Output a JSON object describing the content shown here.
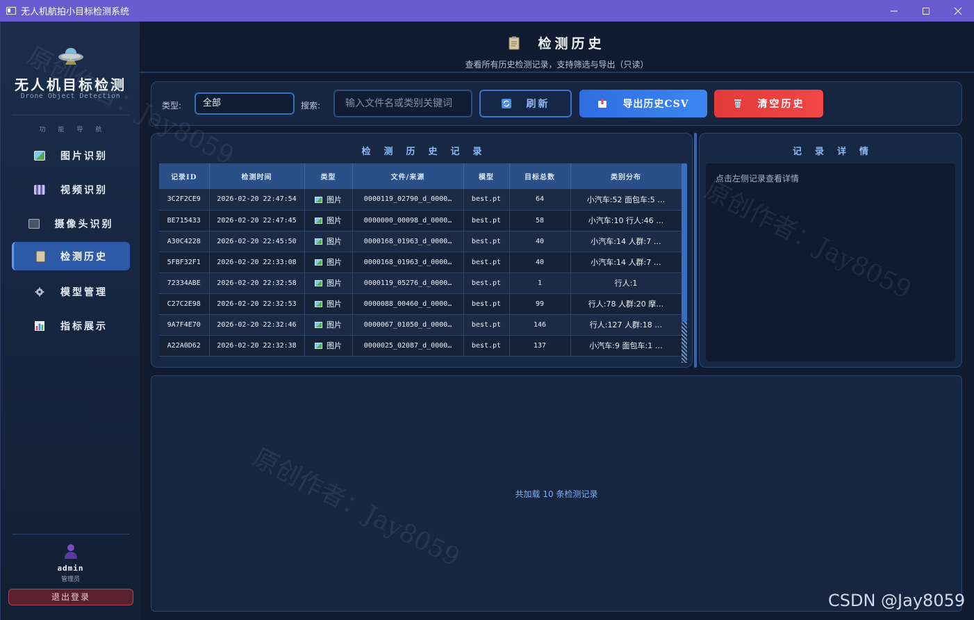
{
  "window": {
    "title": "无人机航拍小目标检测系统"
  },
  "sidebar": {
    "brand": "无人机目标检测",
    "brand_sub": "Drone Object Detection",
    "nav_title": "功能导航",
    "items": [
      {
        "label": "图片识别",
        "icon": "image-icon"
      },
      {
        "label": "视频识别",
        "icon": "clapper-icon"
      },
      {
        "label": "摄像头识别",
        "icon": "camera-icon"
      },
      {
        "label": "检测历史",
        "icon": "clipboard-icon",
        "active": true
      },
      {
        "label": "模型管理",
        "icon": "gear-icon"
      },
      {
        "label": "指标展示",
        "icon": "bar-chart-icon"
      }
    ],
    "user": {
      "name": "admin",
      "role": "管理员"
    },
    "logout_label": "退出登录"
  },
  "header": {
    "title": "检测历史",
    "subtitle": "查看所有历史检测记录，支持筛选与导出（只读）"
  },
  "toolbar": {
    "type_label": "类型:",
    "type_value": "全部",
    "search_label": "搜索:",
    "search_placeholder": "输入文件名或类别关键词",
    "refresh_label": "刷新",
    "export_label": "导出历史CSV",
    "clear_label": "清空历史"
  },
  "records": {
    "title": "检测历史记录",
    "columns": [
      "记录ID",
      "检测时间",
      "类型",
      "文件/来源",
      "模型",
      "目标总数",
      "类别分布"
    ],
    "rows": [
      [
        "3C2F2CE9",
        "2026-02-20 22:47:54",
        "图片",
        "0000119_02790_d_0000…",
        "best.pt",
        "64",
        "小汽车:52  面包车:5 …"
      ],
      [
        "BE715433",
        "2026-02-20 22:47:45",
        "图片",
        "0000000_00098_d_0000…",
        "best.pt",
        "58",
        "小汽车:10  行人:46  …"
      ],
      [
        "A30C4228",
        "2026-02-20 22:45:50",
        "图片",
        "0000168_01963_d_0000…",
        "best.pt",
        "40",
        "小汽车:14  人群:7  …"
      ],
      [
        "5FBF32F1",
        "2026-02-20 22:33:08",
        "图片",
        "0000168_01963_d_0000…",
        "best.pt",
        "40",
        "小汽车:14  人群:7  …"
      ],
      [
        "72334ABE",
        "2026-02-20 22:32:58",
        "图片",
        "0000119_05276_d_0000…",
        "best.pt",
        "1",
        "行人:1"
      ],
      [
        "C27C2E98",
        "2026-02-20 22:32:53",
        "图片",
        "0000088_00460_d_0000…",
        "best.pt",
        "99",
        "行人:78  人群:20  摩…"
      ],
      [
        "9A7F4E70",
        "2026-02-20 22:32:46",
        "图片",
        "0000067_01050_d_0000…",
        "best.pt",
        "146",
        "行人:127  人群:18  …"
      ],
      [
        "A22A0D62",
        "2026-02-20 22:32:38",
        "图片",
        "0000025_02087_d_0000…",
        "best.pt",
        "137",
        "小汽车:9  面包车:1  …"
      ]
    ]
  },
  "detail": {
    "title": "记录详情",
    "placeholder": "点击左侧记录查看详情"
  },
  "footer": {
    "summary": "共加载 10 条检测记录"
  },
  "overlay": {
    "watermark": "原创作者：Jay8059",
    "csdn": "CSDN @Jay8059"
  },
  "colors": {
    "titlebar": "#6a5cd0",
    "accent": "#3c86f2",
    "danger": "#f14646",
    "nav_active": "#2d5aa8"
  }
}
